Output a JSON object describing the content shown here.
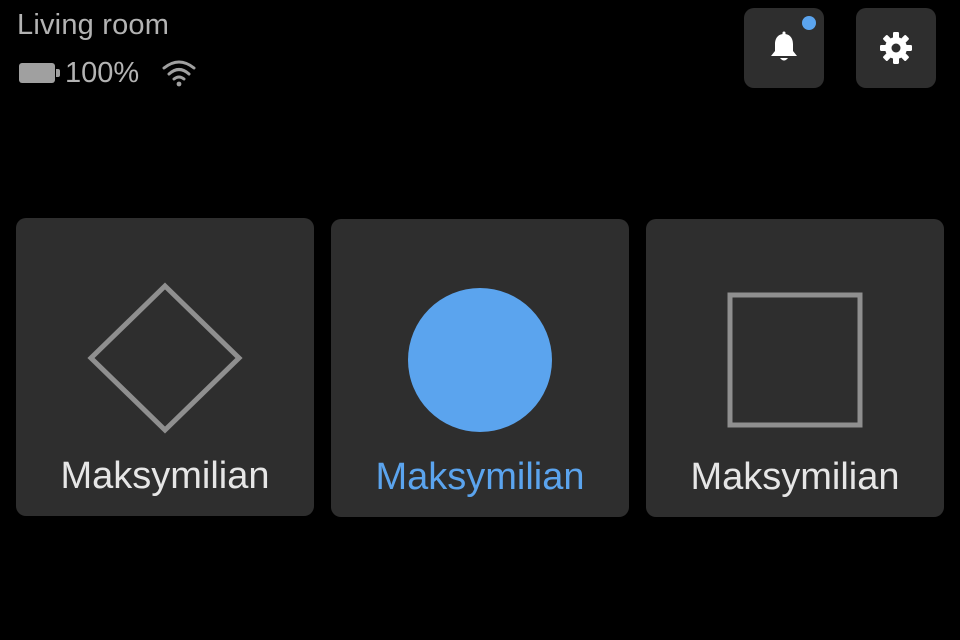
{
  "header": {
    "room_name": "Living room",
    "battery_level": "100%",
    "battery_icon": "battery-full-icon",
    "wifi_icon": "wifi-icon"
  },
  "actions": {
    "notifications_icon": "bell-icon",
    "notifications_unread": true,
    "settings_icon": "gear-icon"
  },
  "cards": [
    {
      "label": "Maksymilian",
      "shape": "diamond-icon",
      "active": false
    },
    {
      "label": "Maksymilian",
      "shape": "circle-icon",
      "active": true
    },
    {
      "label": "Maksymilian",
      "shape": "square-icon",
      "active": false
    }
  ],
  "colors": {
    "background": "#000000",
    "surface": "#2e2e2e",
    "accent": "#5ba4ee",
    "muted": "#b3b3b3",
    "text": "#e6e6e6",
    "shape_outline": "#8f8f8f"
  }
}
